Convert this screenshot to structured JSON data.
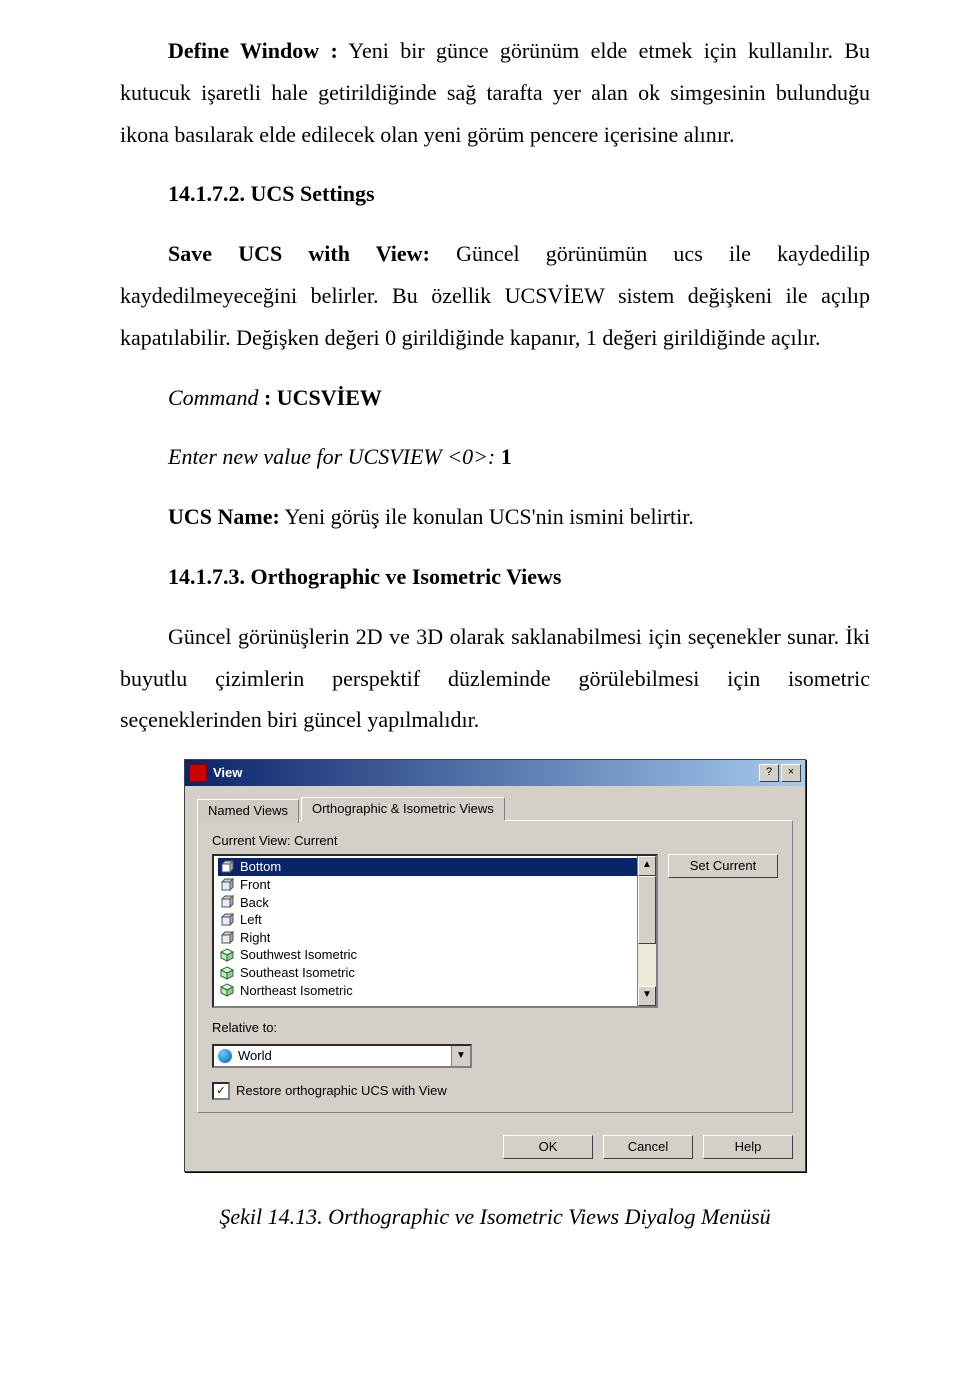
{
  "p1_label": "Define Window :",
  "p1_text": " Yeni bir günce görünüm elde etmek için kullanılır. Bu kutucuk işaretli hale getirildiğinde sağ tarafta yer alan ok simgesinin bulunduğu ikona basılarak elde edilecek olan yeni görüm pencere içerisine alınır.",
  "h1": "14.1.7.2. UCS Settings",
  "p2_label": "Save UCS with View:",
  "p2_text": " Güncel görünümün ucs ile kaydedilip kaydedilmeyeceğini belirler. Bu özellik UCSVİEW sistem değişkeni ile açılıp kapatılabilir. Değişken değeri 0 girildiğinde kapanır, 1 değeri girildiğinde açılır.",
  "cmd_label": "Command",
  "cmd_value": " : UCSVİEW",
  "enter_label": "Enter new value for UCSVIEW <0>:",
  "enter_value": " 1",
  "ucsname_label": "UCS Name:",
  "ucsname_text": " Yeni görüş ile  konulan UCS'nin ismini belirtir.",
  "h2": "14.1.7.3. Orthographic ve Isometric Views",
  "p3": "Güncel görünüşlerin 2D ve 3D olarak saklanabilmesi için seçenekler sunar. İki buyutlu çizimlerin perspektif düzleminde görülebilmesi için isometric seçeneklerinden biri güncel yapılmalıdır.",
  "dialog": {
    "title": "View",
    "help_btn": "?",
    "close_btn": "×",
    "tab_named": "Named Views",
    "tab_ortho": "Orthographic & Isometric Views",
    "current_view_label": "Current View:",
    "current_view_value": "Current",
    "set_current": "Set Current",
    "items": [
      "Bottom",
      "Front",
      "Back",
      "Left",
      "Right",
      "Southwest Isometric",
      "Southeast Isometric",
      "Northeast Isometric"
    ],
    "relative_label": "Relative to:",
    "relative_value": "World",
    "restore_label": "Restore orthographic UCS with View",
    "ok": "OK",
    "cancel": "Cancel",
    "help": "Help"
  },
  "caption": "Şekil 14.13. Orthographic ve Isometric Views Diyalog Menüsü"
}
